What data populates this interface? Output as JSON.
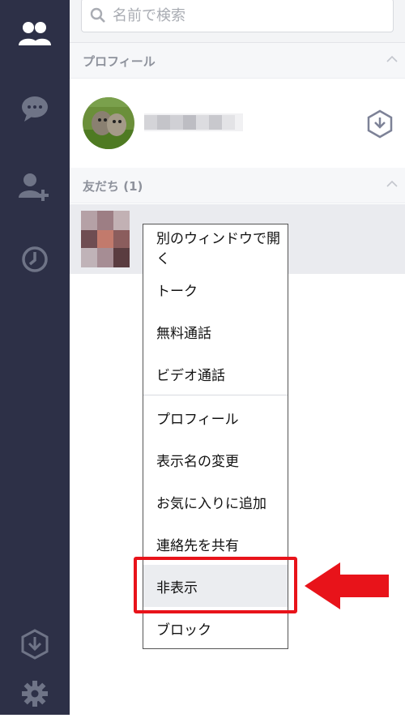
{
  "search": {
    "placeholder": "名前で検索"
  },
  "sections": {
    "profile": {
      "label": "プロフィール"
    },
    "friends": {
      "label": "友だち (1)"
    }
  },
  "context_menu": {
    "items": [
      "別のウィンドウで開く",
      "トーク",
      "無料通話",
      "ビデオ通話",
      "プロフィール",
      "表示名の変更",
      "お気に入りに追加",
      "連絡先を共有",
      "非表示",
      "ブロック"
    ],
    "selected_index": 8
  },
  "icons": {
    "rail": [
      "friends-icon",
      "chat-icon",
      "add-friend-icon",
      "history-icon",
      "download-icon",
      "settings-icon"
    ],
    "search": "search-icon",
    "profile_action": "download-icon"
  },
  "colors": {
    "rail_bg": "#2d3047",
    "highlight": "#e8131a",
    "arrow": "#e8131a"
  }
}
